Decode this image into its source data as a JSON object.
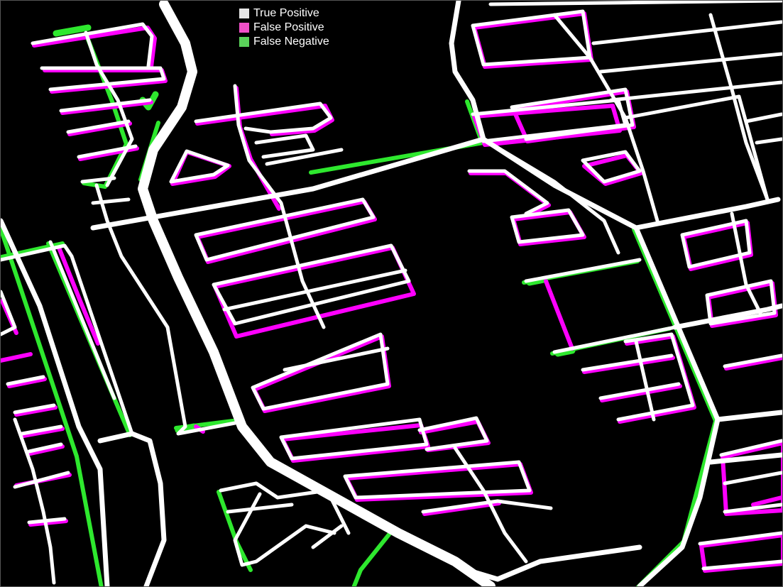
{
  "colors": {
    "background": "#000000",
    "true_positive": "#ffffff",
    "false_positive": "#ff00ff",
    "false_negative": "#2ee82e"
  },
  "legend": {
    "items": [
      {
        "label": "True Positive",
        "color": "#e6e6e6"
      },
      {
        "label": "False Positive",
        "color": "#f050c8"
      },
      {
        "label": "False Negative",
        "color": "#5ad25a"
      }
    ]
  }
}
